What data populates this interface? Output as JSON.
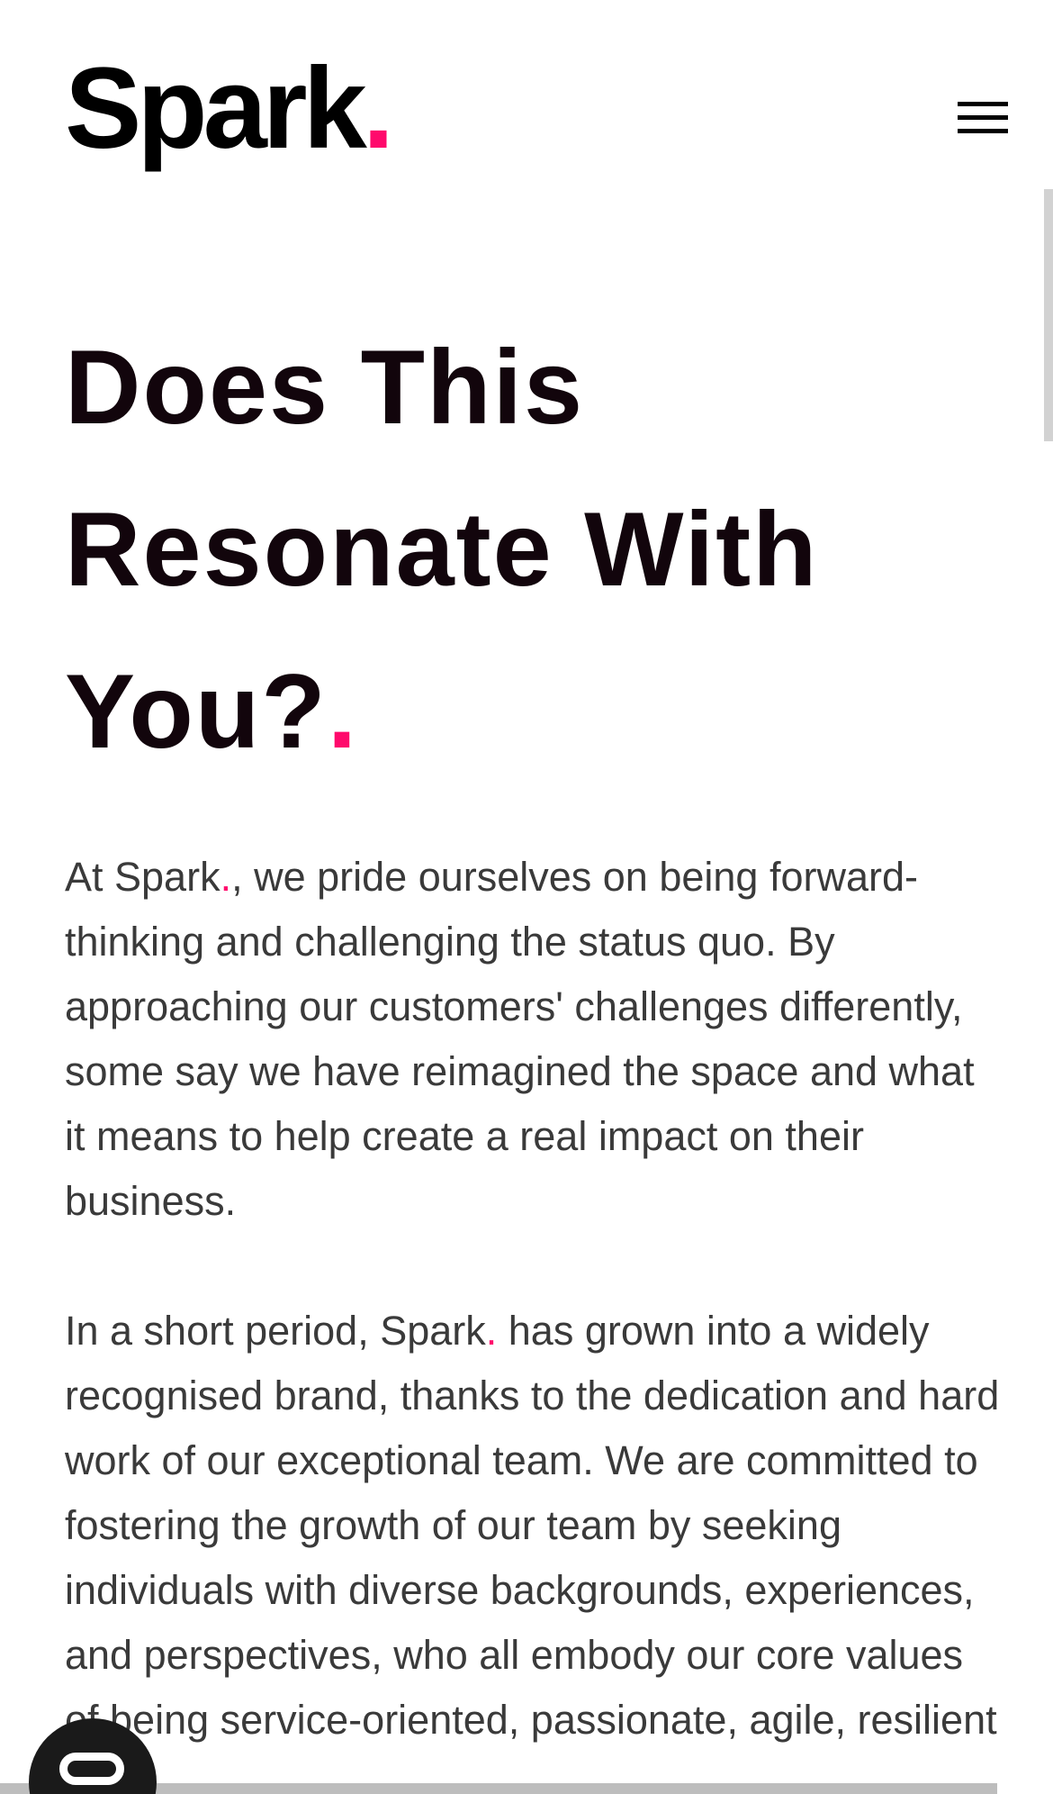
{
  "header": {
    "logo_text": "Spark",
    "logo_dot": ".",
    "menu_icon": "hamburger-menu-icon"
  },
  "hero": {
    "heading_line1": "Does This",
    "heading_line2": "Resonate With",
    "heading_line3": "You?",
    "heading_dot": "."
  },
  "content": {
    "p1_intro": "At Spark",
    "p1_dot": ".",
    "p1_rest": ", we pride ourselves on being forward-thinking and challenging the status quo. By approaching our customers' challenges differently, some say we have reimagined the space and what it means to help create a real impact on their business.",
    "p2_intro": "In a short period, Spark",
    "p2_dot": ".",
    "p2_rest": " has grown into a widely recognised brand, thanks to the dedication and hard work of our exceptional team. We are committed to fostering the growth of our team by seeking individuals with diverse backgrounds, experiences, and perspectives, who all embody our core values of being service-oriented, passionate, agile, resilient"
  },
  "widgets": {
    "fab_icon": "chat-toggle-icon"
  },
  "colors": {
    "accent": "#ff0a6c",
    "heading": "#12050c",
    "body": "#3a3a3a"
  }
}
